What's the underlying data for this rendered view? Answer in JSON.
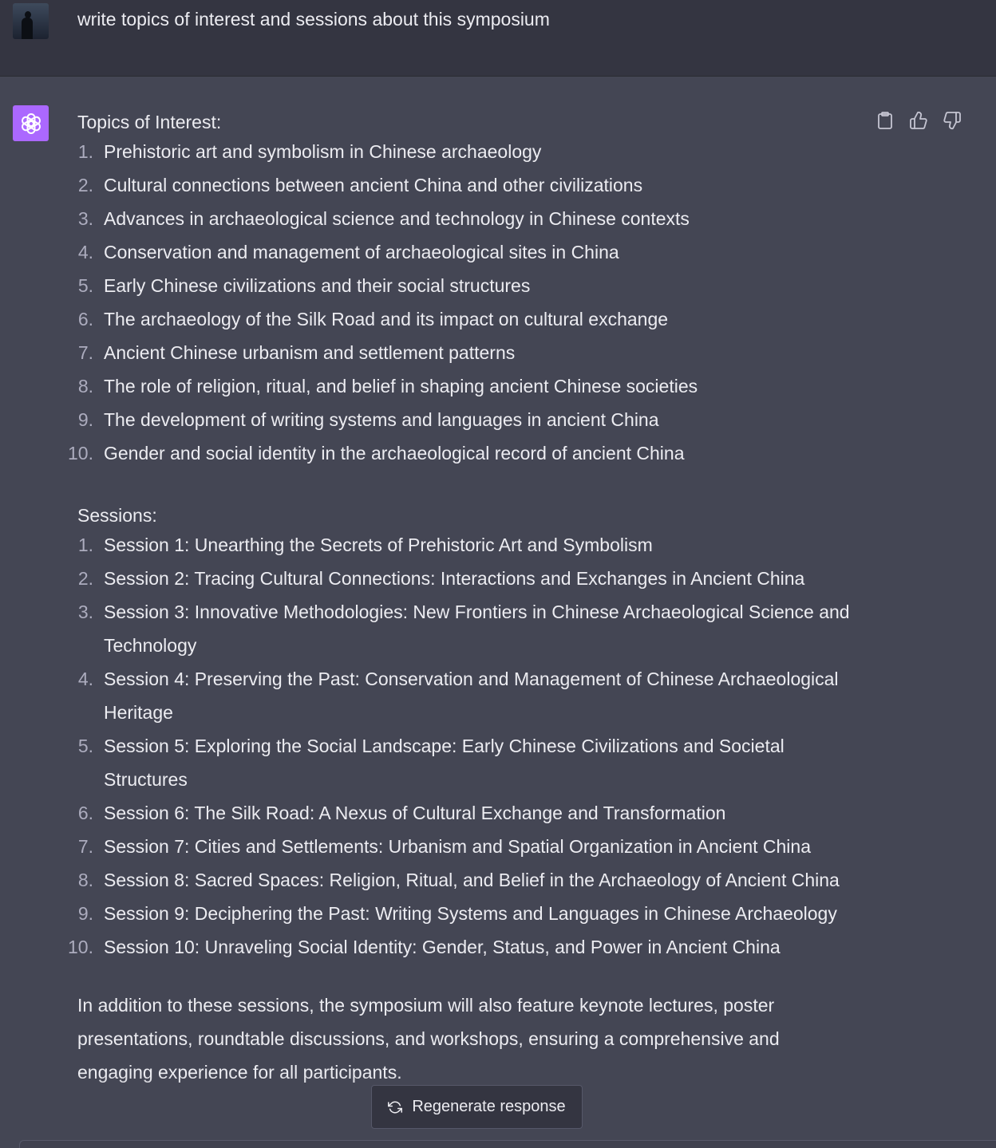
{
  "user_message": {
    "text": "write topics of interest and sessions about this symposium"
  },
  "assistant_message": {
    "topics_heading": "Topics of Interest:",
    "topics": [
      {
        "num": "1.",
        "text": "Prehistoric art and symbolism in Chinese archaeology"
      },
      {
        "num": "2.",
        "text": "Cultural connections between ancient China and other civilizations"
      },
      {
        "num": "3.",
        "text": "Advances in archaeological science and technology in Chinese contexts"
      },
      {
        "num": "4.",
        "text": "Conservation and management of archaeological sites in China"
      },
      {
        "num": "5.",
        "text": "Early Chinese civilizations and their social structures"
      },
      {
        "num": "6.",
        "text": "The archaeology of the Silk Road and its impact on cultural exchange"
      },
      {
        "num": "7.",
        "text": "Ancient Chinese urbanism and settlement patterns"
      },
      {
        "num": "8.",
        "text": "The role of religion, ritual, and belief in shaping ancient Chinese societies"
      },
      {
        "num": "9.",
        "text": "The development of writing systems and languages in ancient China"
      },
      {
        "num": "10.",
        "text": "Gender and social identity in the archaeological record of ancient China"
      }
    ],
    "sessions_heading": "Sessions:",
    "sessions": [
      {
        "num": "1.",
        "text": "Session 1: Unearthing the Secrets of Prehistoric Art and Symbolism"
      },
      {
        "num": "2.",
        "text": "Session 2: Tracing Cultural Connections: Interactions and Exchanges in Ancient China"
      },
      {
        "num": "3.",
        "text": "Session 3: Innovative Methodologies: New Frontiers in Chinese Archaeological Science and Technology"
      },
      {
        "num": "4.",
        "text": "Session 4: Preserving the Past: Conservation and Management of Chinese Archaeological Heritage"
      },
      {
        "num": "5.",
        "text": "Session 5: Exploring the Social Landscape: Early Chinese Civilizations and Societal Structures"
      },
      {
        "num": "6.",
        "text": "Session 6: The Silk Road: A Nexus of Cultural Exchange and Transformation"
      },
      {
        "num": "7.",
        "text": "Session 7: Cities and Settlements: Urbanism and Spatial Organization in Ancient China"
      },
      {
        "num": "8.",
        "text": "Session 8: Sacred Spaces: Religion, Ritual, and Belief in the Archaeology of Ancient China"
      },
      {
        "num": "9.",
        "text": "Session 9: Deciphering the Past: Writing Systems and Languages in Chinese Archaeology"
      },
      {
        "num": "10.",
        "text": "Session 10: Unraveling Social Identity: Gender, Status, and Power in Ancient China"
      }
    ],
    "closing": "In addition to these sessions, the symposium will also feature keynote lectures, poster presentations, roundtable discussions, and workshops, ensuring a comprehensive and engaging experience for all participants."
  },
  "actions": {
    "copy_icon": "clipboard-icon",
    "like_icon": "thumbs-up-icon",
    "dislike_icon": "thumbs-down-icon"
  },
  "regenerate": {
    "label": "Regenerate response",
    "icon": "refresh-icon"
  },
  "colors": {
    "user_bg": "#343541",
    "assistant_bg": "#444654",
    "assistant_avatar": "#ab68ff",
    "text": "#ececf1",
    "list_number": "#acacbe"
  }
}
